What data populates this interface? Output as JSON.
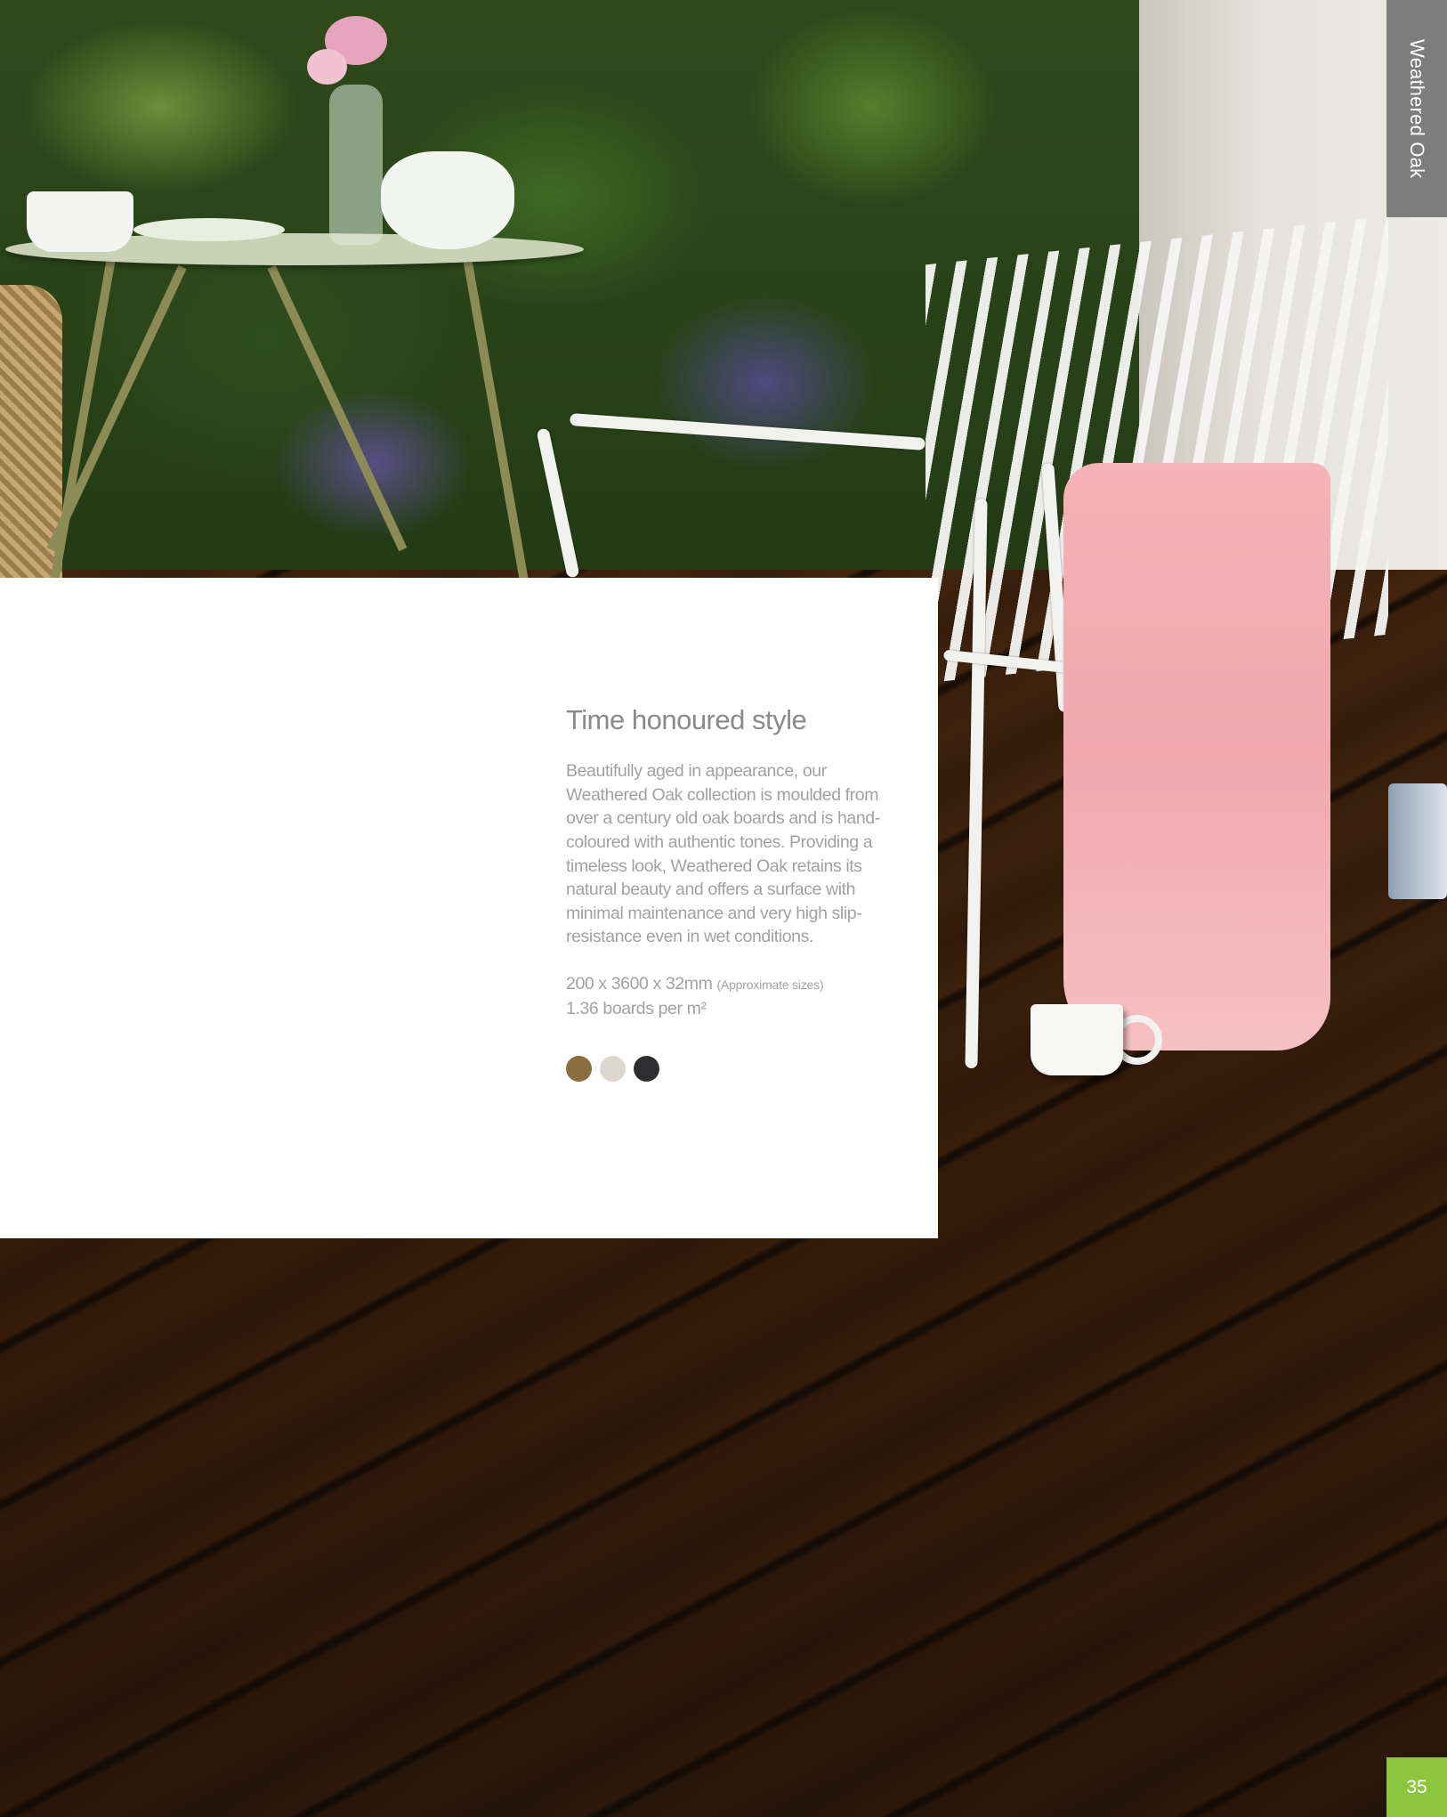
{
  "section_tab": {
    "label": "Weathered Oak"
  },
  "content": {
    "heading": "Time honoured style",
    "body": "Beautifully aged in appearance, our Weathered Oak collection is moulded from over a century old oak boards and is hand-coloured with authentic tones. Providing a timeless look, Weathered Oak retains its natural beauty and offers a surface with minimal maintenance and very high slip-resistance even in wet conditions.",
    "dimensions": "200 x 3600 x 32mm",
    "dimensions_note": "(Approximate sizes)",
    "coverage": "1.36 boards per m²"
  },
  "swatches": [
    {
      "color": "#8a6d3e"
    },
    {
      "color": "#dcd8d0"
    },
    {
      "color": "#2e2e30"
    }
  ],
  "page_number": "35",
  "colors": {
    "section_tab": "#7d7d7d",
    "page_tab": "#8cc63f"
  }
}
